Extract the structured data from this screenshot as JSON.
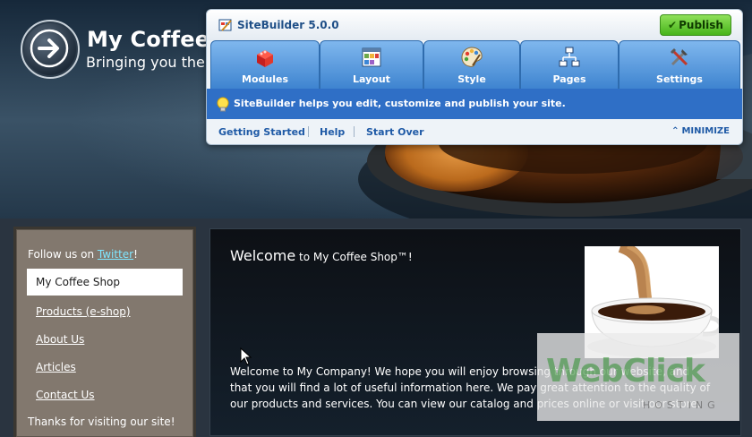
{
  "site": {
    "title": "My Coffee S",
    "tagline": "Bringing you the bes"
  },
  "sitebuilder": {
    "title": "SiteBuilder 5.0.0",
    "publish_label": "Publish",
    "tabs": [
      {
        "label": "Modules",
        "icon": "modules-icon"
      },
      {
        "label": "Layout",
        "icon": "layout-icon"
      },
      {
        "label": "Style",
        "icon": "style-icon"
      },
      {
        "label": "Pages",
        "icon": "pages-icon"
      },
      {
        "label": "Settings",
        "icon": "settings-icon"
      }
    ],
    "info_message": "SiteBuilder helps you edit, customize and publish your site.",
    "links": {
      "getting_started": "Getting Started",
      "help": "Help",
      "start_over": "Start Over",
      "minimize": "MINIMIZE"
    }
  },
  "sidebar": {
    "follow_prefix": "Follow us on ",
    "follow_link": "Twitter",
    "follow_suffix": "!",
    "nav": [
      {
        "label": "My Coffee Shop"
      },
      {
        "label": "Products (e-shop)"
      },
      {
        "label": "About Us"
      },
      {
        "label": "Articles"
      },
      {
        "label": "Contact Us"
      }
    ],
    "thanks": "Thanks for visiting our site!"
  },
  "content": {
    "welcome_big": "Welcome",
    "welcome_small": " to My Coffee Shop™!",
    "body": "Welcome to My Company! We hope you will enjoy browsing through our website, and that you will find a lot of useful information here. We pay great attention to the quality of our products and services. You can view our catalog and prices online or visit our store."
  },
  "watermark": {
    "text": "WebClick",
    "sub": "HOSTING"
  },
  "colors": {
    "accent_blue": "#2f6fc6",
    "publish_green": "#47b41a",
    "twitter_link": "#7fe6ff"
  }
}
